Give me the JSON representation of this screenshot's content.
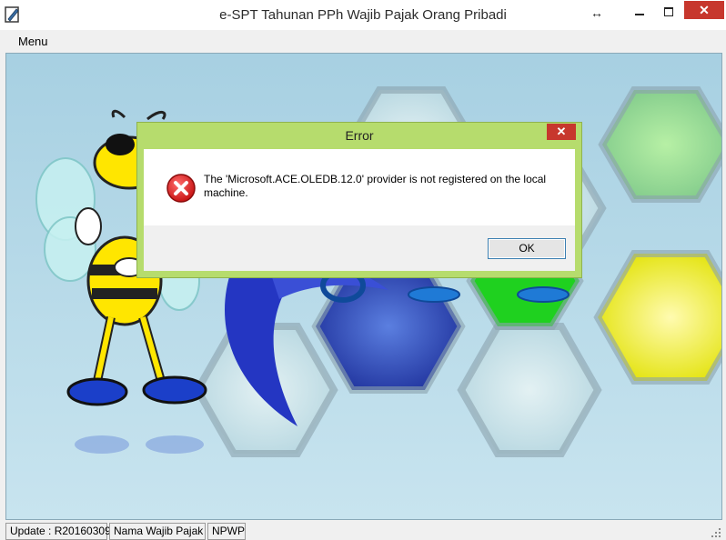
{
  "window": {
    "title": "e-SPT Tahunan PPh Wajib Pajak Orang Pribadi",
    "resize_glyph": "↔",
    "close_glyph": "✕"
  },
  "menubar": {
    "items": [
      {
        "label": "Menu"
      }
    ]
  },
  "dialog": {
    "title": "Error",
    "close_glyph": "✕",
    "message": "The 'Microsoft.ACE.OLEDB.12.0' provider is not registered on the local machine.",
    "ok_label": "OK"
  },
  "statusbar": {
    "panels": [
      {
        "text": "Update : R20160309"
      },
      {
        "text": "Nama Wajib Pajak"
      },
      {
        "text": "NPWP"
      }
    ]
  },
  "colors": {
    "dialog_frame": "#b6dc6d",
    "close_button": "#c7372d",
    "background": "#abd2e2"
  }
}
